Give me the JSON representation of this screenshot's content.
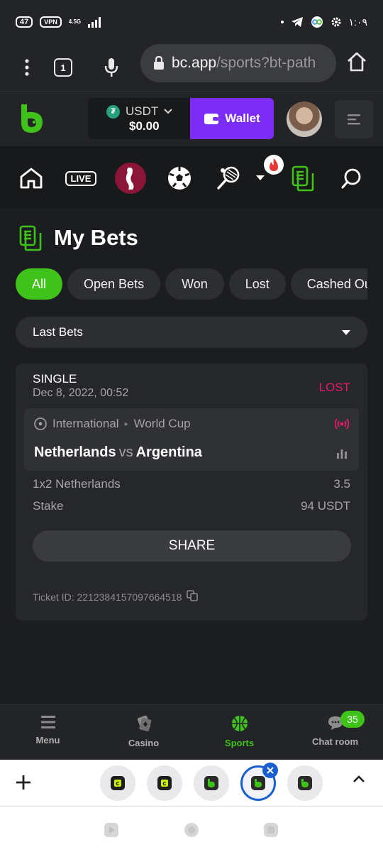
{
  "status_bar": {
    "battery": "47",
    "vpn": "VPN",
    "network": "4.5G",
    "time": "١:٠٩"
  },
  "browser": {
    "tab_count": "1",
    "url_host": "bc.app",
    "url_path": "/sports?bt-path"
  },
  "header": {
    "currency": "USDT",
    "balance": "$0.00",
    "wallet_label": "Wallet",
    "tether_glyph": "₮"
  },
  "sports_nav": {
    "live_label": "LIVE"
  },
  "page": {
    "title": "My Bets",
    "filters": [
      "All",
      "Open Bets",
      "Won",
      "Lost",
      "Cashed Out"
    ],
    "active_filter": "All",
    "select_value": "Last Bets"
  },
  "bet": {
    "type": "SINGLE",
    "date": "Dec 8, 2022, 00:52",
    "status": "LOST",
    "status_color": "#e6196b",
    "category": "International",
    "league": "World Cup",
    "home_team": "Netherlands",
    "vs": "vs",
    "away_team": "Argentina",
    "selection": "1x2 Netherlands",
    "odds": "3.5",
    "stake_label": "Stake",
    "stake_value": "94 USDT",
    "share_label": "SHARE",
    "ticket_id": "Ticket ID: 2212384157097664518"
  },
  "bottom_nav": {
    "items": [
      "Menu",
      "Casino",
      "Sports",
      "Chat room"
    ],
    "active": "Sports",
    "chat_count": "35"
  },
  "colors": {
    "accent_green": "#3fc21a",
    "wallet_purple": "#7b2cf5",
    "lost_red": "#e6196b",
    "background": "#1c1d20"
  }
}
